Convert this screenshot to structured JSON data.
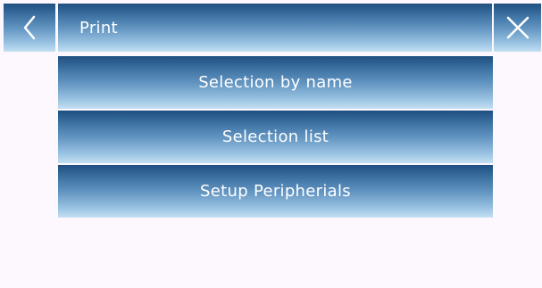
{
  "header": {
    "title": "Print",
    "back_icon": "chevron-left-icon",
    "close_icon": "close-icon"
  },
  "menu": {
    "items": [
      {
        "label": "Selection by name"
      },
      {
        "label": "Selection list"
      },
      {
        "label": "Setup Peripherials"
      }
    ]
  },
  "colors": {
    "background": "#fdf8fd",
    "button_gradient_top": "#1e4f80",
    "button_gradient_bottom": "#c4e0f2",
    "text": "#ffffff"
  }
}
